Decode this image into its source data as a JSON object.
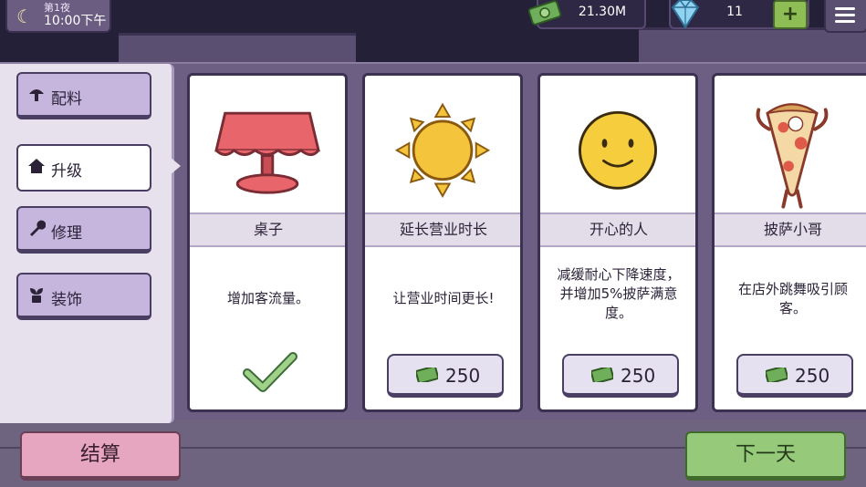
{
  "hud": {
    "night": "第1夜",
    "time": "10:00下午",
    "money": "21.30M",
    "gems": "11",
    "plus_label": "+"
  },
  "sidebar": {
    "items": [
      {
        "label": "配料",
        "icon": "mushroom-icon"
      },
      {
        "label": "升级",
        "icon": "home-icon",
        "active": true
      },
      {
        "label": "修理",
        "icon": "wrench-icon"
      },
      {
        "label": "装饰",
        "icon": "plant-icon"
      }
    ]
  },
  "cards": [
    {
      "title": "桌子",
      "desc": "增加客流量。",
      "purchased": true,
      "art": "table-icon"
    },
    {
      "title": "延长营业时长",
      "desc": "让营业时间更长!",
      "price": "250",
      "art": "sun-icon"
    },
    {
      "title": "开心的人",
      "desc": "减缓耐心下降速度，并增加5%披萨满意度。",
      "price": "250",
      "art": "smiley-icon"
    },
    {
      "title": "披萨小哥",
      "desc": "在店外跳舞吸引顾客。",
      "price": "250",
      "art": "pizza-mascot-icon"
    }
  ],
  "footer": {
    "checkout_label": "结算",
    "next_day_label": "下一天"
  },
  "colors": {
    "checkout": "#e7a6bf",
    "next_day": "#96c97a",
    "panel": "#6d5f83"
  }
}
